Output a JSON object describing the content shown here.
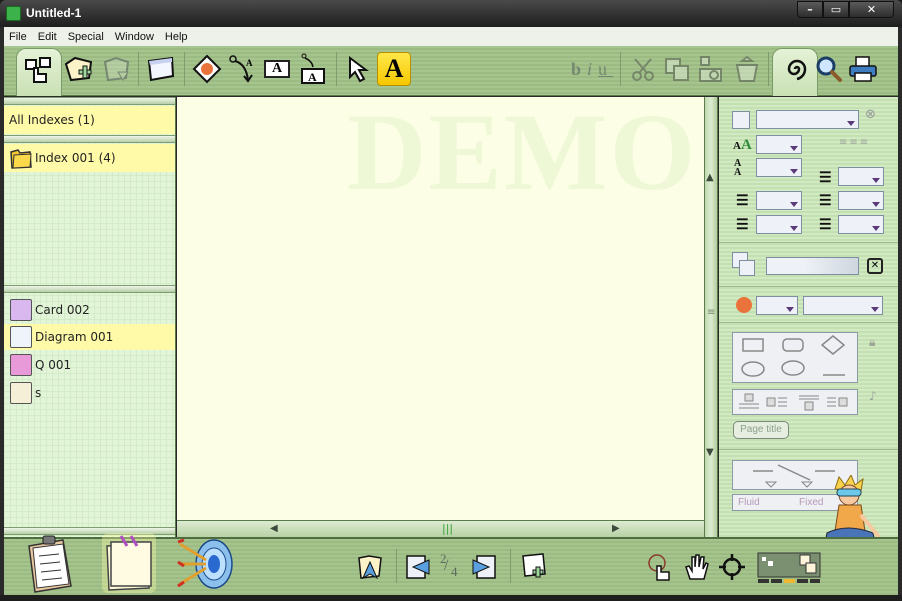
{
  "window": {
    "title": "Untitled-1",
    "controls": {
      "minimize": "–",
      "maximize": "▭",
      "close": "✕"
    }
  },
  "menu": [
    "File",
    "Edit",
    "Special",
    "Window",
    "Help"
  ],
  "toolbar": {
    "left_tools": [
      {
        "name": "link-index-tool",
        "icon": "hand-pointer-folders-icon",
        "active": true
      },
      {
        "name": "new-index-tool",
        "icon": "folder-plus-icon"
      },
      {
        "name": "index-down-tool",
        "icon": "folder-arrow-icon",
        "disabled": true
      },
      {
        "name": "new-card-tool",
        "icon": "card-icon"
      },
      {
        "name": "image-tool",
        "icon": "picture-icon"
      },
      {
        "name": "connector-label-tool",
        "icon": "connector-a-icon"
      },
      {
        "name": "text-box-tool",
        "icon": "text-box-icon",
        "glyph": "A"
      },
      {
        "name": "linked-text-tool",
        "icon": "linked-text-icon",
        "glyph": "A"
      },
      {
        "name": "select-tool",
        "icon": "arrow-cursor-icon"
      },
      {
        "name": "text-tool",
        "icon": "big-a-icon",
        "glyph": "A",
        "active": true
      }
    ],
    "format": {
      "bold": "b",
      "italic": "i",
      "underline": "u"
    },
    "edit_tools": [
      "cut",
      "copy",
      "paste",
      "delete"
    ],
    "right_tools": [
      "spiral",
      "search",
      "print"
    ]
  },
  "left_panel": {
    "all_indexes": "All Indexes (1)",
    "indexes": [
      {
        "label": "Index 001 (4)",
        "selected": true
      }
    ],
    "items": [
      {
        "label": "Card 002",
        "type": "card",
        "selected": false
      },
      {
        "label": "Diagram 001",
        "type": "diagram",
        "selected": true
      },
      {
        "label": "Q 001",
        "type": "question",
        "selected": false
      },
      {
        "label": "s",
        "type": "timeline",
        "selected": false
      }
    ]
  },
  "canvas": {
    "watermark": "DEMO"
  },
  "right_panel": {
    "page_title_button": "Page title",
    "layout_labels": {
      "fluid": "Fluid",
      "fixed": "Fixed"
    },
    "font_size_label": "AA"
  },
  "bottom_bar": {
    "page_current": "2",
    "page_total": "4",
    "left_tools": [
      "checklist",
      "notes",
      "target"
    ],
    "right_tools": [
      "zoom-pointer",
      "hand-pan",
      "crosshair",
      "navigator"
    ]
  },
  "colors": {
    "toolbar_green": "#a6c48e",
    "highlight_yellow": "#fffaa8",
    "canvas_bg": "#fdfee6",
    "panel_green": "#e2f5d8",
    "active_text_tool": "#f7c800"
  }
}
